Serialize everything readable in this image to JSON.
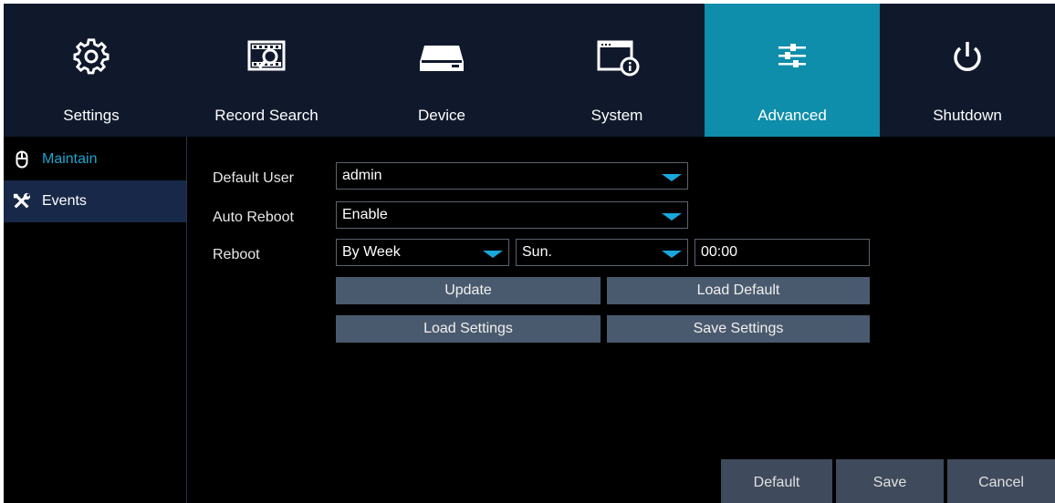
{
  "topnav": {
    "tabs": [
      {
        "label": "Settings",
        "icon": "gear-icon"
      },
      {
        "label": "Record Search",
        "icon": "film-search-icon"
      },
      {
        "label": "Device",
        "icon": "hard-drive-icon"
      },
      {
        "label": "System",
        "icon": "system-info-icon"
      },
      {
        "label": "Advanced",
        "icon": "sliders-icon",
        "active": true
      },
      {
        "label": "Shutdown",
        "icon": "power-icon"
      }
    ]
  },
  "sidebar": {
    "items": [
      {
        "label": "Maintain",
        "icon": "mouse-icon",
        "selected": true
      },
      {
        "label": "Events",
        "icon": "tools-icon"
      }
    ]
  },
  "form": {
    "default_user": {
      "label": "Default User",
      "value": "admin"
    },
    "auto_reboot": {
      "label": "Auto Reboot",
      "value": "Enable"
    },
    "reboot": {
      "label": "Reboot",
      "period": "By Week",
      "day": "Sun.",
      "time": "00:00"
    },
    "buttons": {
      "update": "Update",
      "load_default": "Load Default",
      "load_settings": "Load Settings",
      "save_settings": "Save Settings"
    }
  },
  "footer": {
    "default": "Default",
    "save": "Save",
    "cancel": "Cancel"
  },
  "colors": {
    "nav_bg": "#10192c",
    "active_tab": "#0e8eaa",
    "accent": "#19a7dc",
    "button_bg": "#4a5a6e",
    "sidebar_selected": "#182848"
  }
}
